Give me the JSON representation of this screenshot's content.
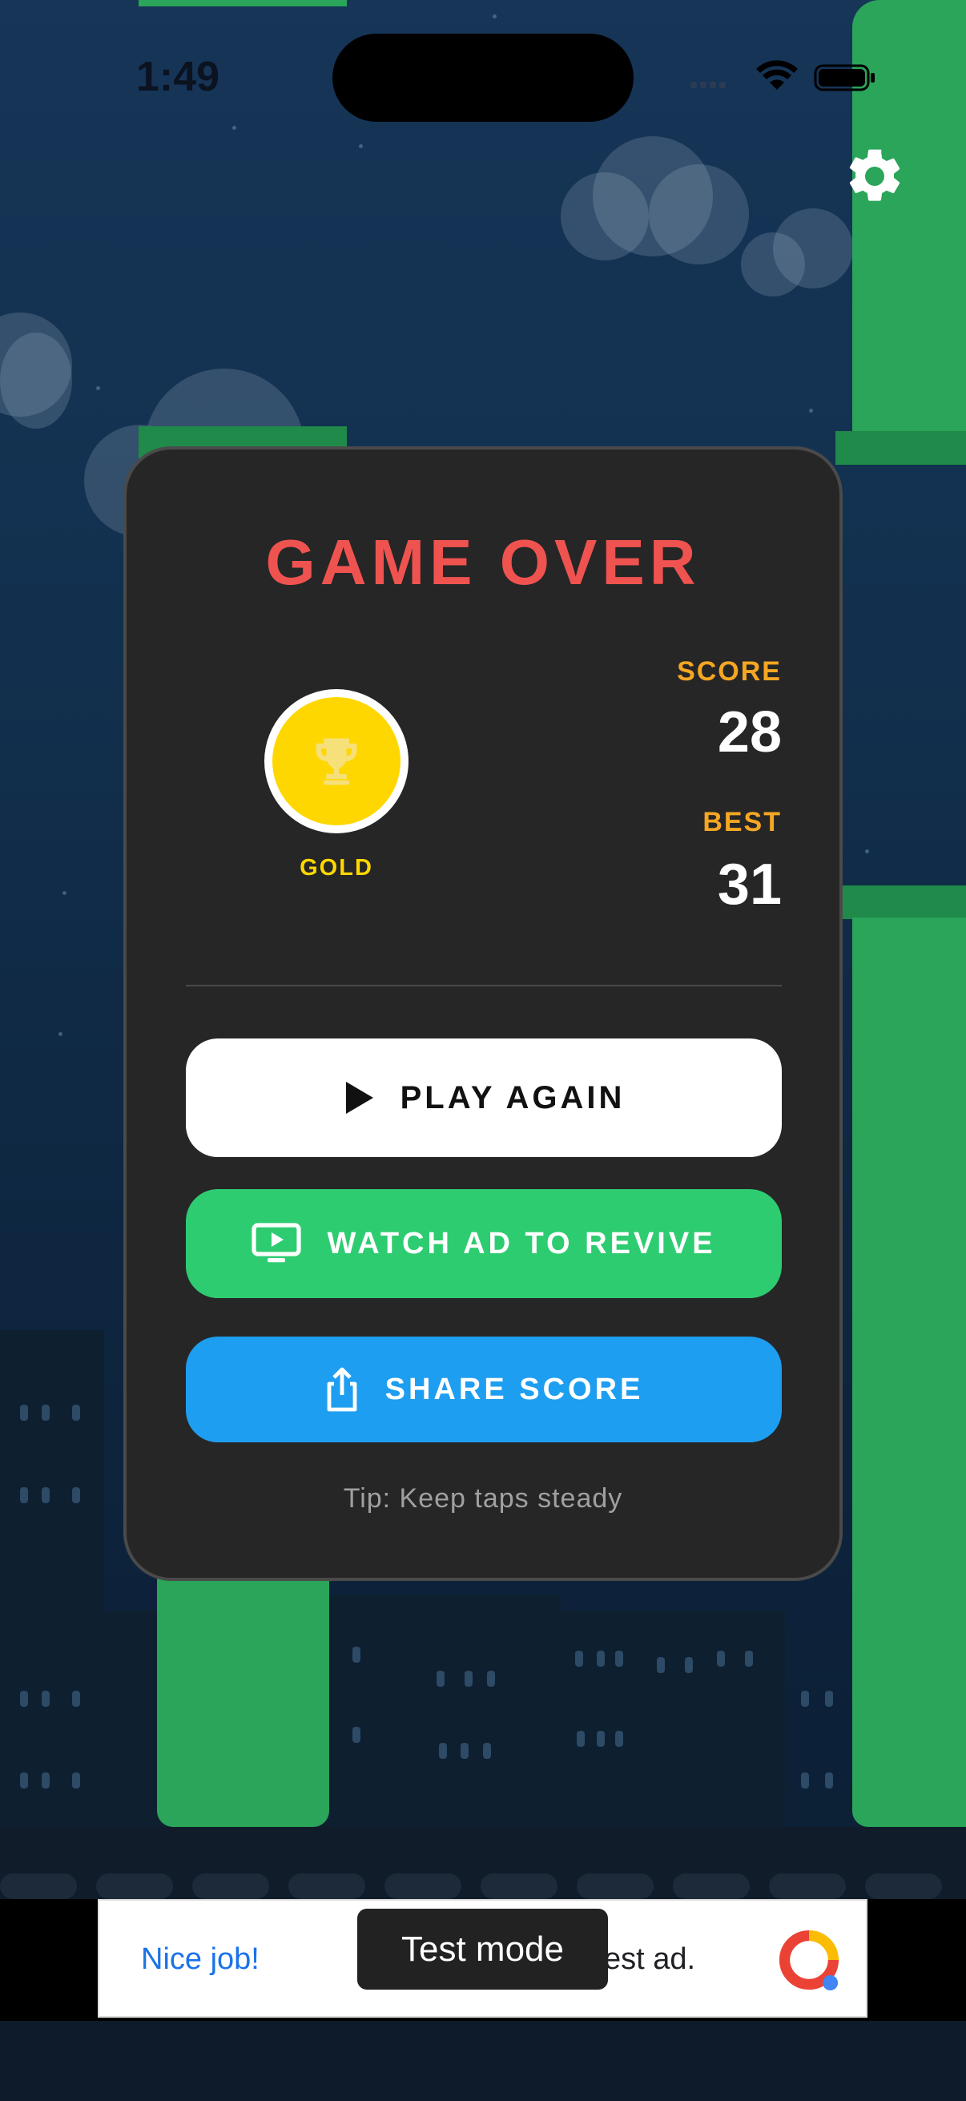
{
  "status_bar": {
    "time": "1:49"
  },
  "game_over": {
    "title": "GAME OVER",
    "medal": {
      "label": "GOLD",
      "color": "#ffd700",
      "icon": "trophy-icon"
    },
    "score_label": "SCORE",
    "score_value": "28",
    "best_label": "BEST",
    "best_value": "31",
    "buttons": {
      "play_again": "PLAY AGAIN",
      "watch_ad": "WATCH AD TO REVIVE",
      "share": "SHARE SCORE"
    },
    "tip": "Tip: Keep taps steady"
  },
  "ad_banner": {
    "text_left": "Nice job!",
    "text_right": "est ad.",
    "toast": "Test mode"
  },
  "colors": {
    "title": "#ef5350",
    "stat_label": "#f5a623",
    "watch_button": "#2ecc71",
    "share_button": "#1e9ef0",
    "pipe": "#2aa55a"
  }
}
